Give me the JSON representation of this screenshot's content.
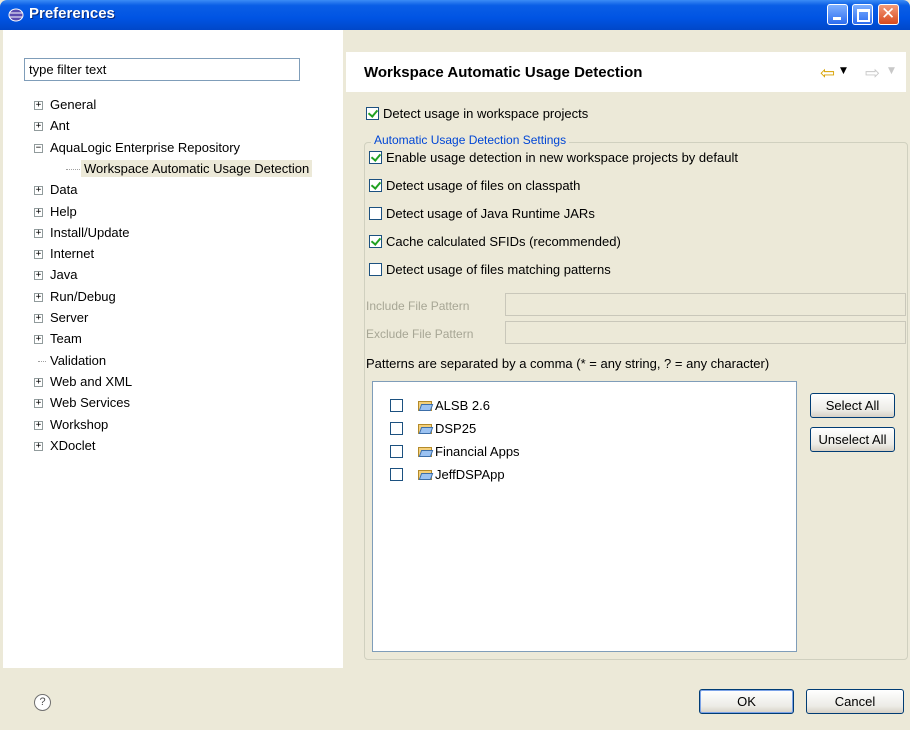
{
  "window": {
    "title": "Preferences"
  },
  "filter": {
    "value": "type filter text"
  },
  "tree": [
    {
      "label": "General",
      "expander": "+"
    },
    {
      "label": "Ant",
      "expander": "+"
    },
    {
      "label": "AquaLogic Enterprise Repository",
      "expander": "−"
    },
    {
      "label": "Workspace Automatic Usage Detection",
      "expander": "",
      "selected": true
    },
    {
      "label": "Data",
      "expander": "+"
    },
    {
      "label": "Help",
      "expander": "+"
    },
    {
      "label": "Install/Update",
      "expander": "+"
    },
    {
      "label": "Internet",
      "expander": "+"
    },
    {
      "label": "Java",
      "expander": "+"
    },
    {
      "label": "Run/Debug",
      "expander": "+"
    },
    {
      "label": "Server",
      "expander": "+"
    },
    {
      "label": "Team",
      "expander": "+"
    },
    {
      "label": "Validation",
      "expander": ""
    },
    {
      "label": "Web and XML",
      "expander": "+"
    },
    {
      "label": "Web Services",
      "expander": "+"
    },
    {
      "label": "Workshop",
      "expander": "+"
    },
    {
      "label": "XDoclet",
      "expander": "+"
    }
  ],
  "page": {
    "title": "Workspace Automatic Usage Detection",
    "detect_workspace": {
      "label": "Detect usage in workspace projects",
      "checked": true
    },
    "group_title": "Automatic Usage Detection Settings",
    "options": [
      {
        "label": "Enable usage detection in new workspace projects by default",
        "checked": true
      },
      {
        "label": "Detect usage of files on classpath",
        "checked": true
      },
      {
        "label": "Detect usage of Java Runtime JARs",
        "checked": false
      },
      {
        "label": "Cache calculated SFIDs (recommended)",
        "checked": true
      },
      {
        "label": "Detect usage of files matching patterns",
        "checked": false
      }
    ],
    "include_label": "Include File Pattern",
    "include_value": "",
    "exclude_label": "Exclude File Pattern",
    "exclude_value": "",
    "hint": "Patterns are separated by a comma (* = any string, ? = any character)",
    "projects": [
      {
        "label": "ALSB 2.6",
        "checked": false
      },
      {
        "label": "DSP25",
        "checked": false
      },
      {
        "label": "Financial Apps",
        "checked": false
      },
      {
        "label": "JeffDSPApp",
        "checked": false
      }
    ],
    "select_all": "Select All",
    "unselect_all": "Unselect All"
  },
  "nav": {
    "back_icon": "arrow-left",
    "forward_icon": "arrow-right"
  },
  "footer": {
    "help": "?",
    "ok": "OK",
    "cancel": "Cancel"
  },
  "colors": {
    "titlebar": "#0054e3",
    "group_title": "#0046d5",
    "dialog_bg": "#ece9d8"
  }
}
